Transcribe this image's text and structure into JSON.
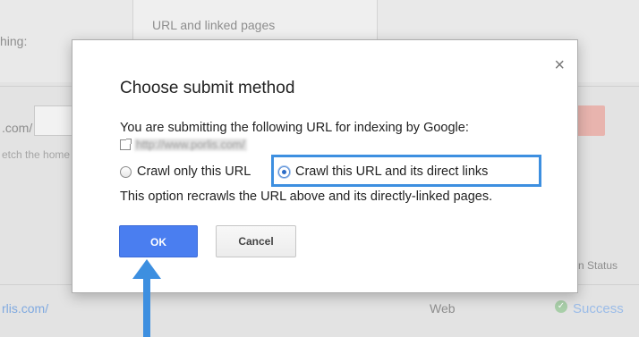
{
  "background": {
    "left_label_partial": "hing:",
    "url_column_header_line1": "URL and linked pages",
    "domain_partial": ".com/",
    "fetch_hint_partial": "etch the home",
    "status_column_header_partial": "n Status",
    "row_url_partial": "rlis.com/",
    "row_type": "Web",
    "row_status": "Success",
    "row_status_color": "#9ccb9c"
  },
  "dialog": {
    "close_glyph": "×",
    "title": "Choose submit method",
    "description": "You are submitting the following URL for indexing by Google:",
    "submitted_url": "http://www.porlis.com/",
    "option_crawl_only": "Crawl only this URL",
    "option_crawl_links": "Crawl this URL and its direct links",
    "selected_option": "Crawl this URL and its direct links",
    "option_note": "This option recrawls the URL above and its directly-linked pages.",
    "ok_label": "OK",
    "cancel_label": "Cancel"
  },
  "colors": {
    "highlight_box": "#3d8fe0",
    "ok_button": "#4a7ef0",
    "annotation_arrow": "#3d8fe0"
  }
}
